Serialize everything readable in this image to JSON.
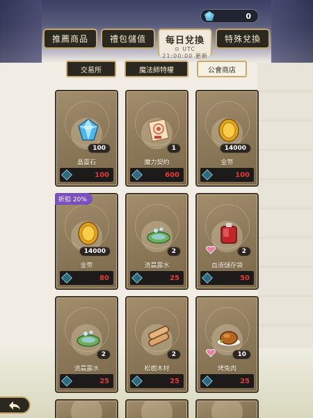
{
  "currency": {
    "icon": "gem-icon",
    "value": "0"
  },
  "top_tabs": [
    {
      "label": "推薦商品",
      "active": false
    },
    {
      "label": "禮包儲值",
      "active": false
    },
    {
      "label": "每日兌換",
      "active": true,
      "timezone": "UTC",
      "refresh": "21:00:00 更新"
    },
    {
      "label": "特殊兌換",
      "active": false
    }
  ],
  "sub_tabs": [
    {
      "label": "交易所",
      "active": false
    },
    {
      "label": "魔法師特權",
      "active": false
    },
    {
      "label": "公會商店",
      "active": true
    }
  ],
  "items": [
    {
      "name": "晶靈石",
      "qty": "100",
      "price": "100",
      "icon": "crystal-icon"
    },
    {
      "name": "魔力契約",
      "qty": "1",
      "price": "600",
      "icon": "scroll-icon"
    },
    {
      "name": "金幣",
      "qty": "14000",
      "price": "100",
      "icon": "gold-coin-icon"
    },
    {
      "name": "金幣",
      "qty": "14000",
      "price": "80",
      "icon": "gold-coin-icon",
      "badge": "折扣 20%"
    },
    {
      "name": "清晨露水",
      "qty": "2",
      "price": "25",
      "icon": "dew-leaf-icon"
    },
    {
      "name": "血液儲存袋",
      "qty": "2",
      "price": "50",
      "icon": "blood-bag-icon",
      "heart": true
    },
    {
      "name": "清晨露水",
      "qty": "2",
      "price": "25",
      "icon": "dew-leaf-icon"
    },
    {
      "name": "松樹木材",
      "qty": "2",
      "price": "25",
      "icon": "wood-log-icon"
    },
    {
      "name": "烤兔肉",
      "qty": "10",
      "price": "25",
      "icon": "roast-meat-icon",
      "heart": true
    }
  ],
  "colors": {
    "price_red": "#e23a3a",
    "badge_purple": "#7a4fc0",
    "gold_border": "#c9a96b"
  }
}
